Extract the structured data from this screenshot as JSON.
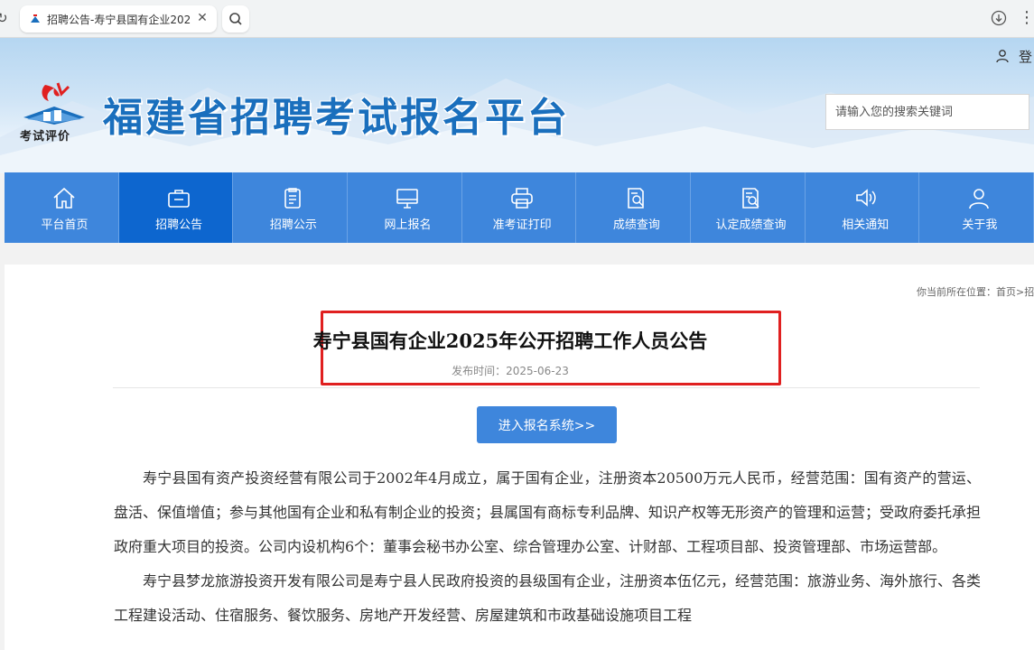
{
  "browser": {
    "tab_title": "招聘公告-寿宁县国有企业202",
    "close_glyph": "✕"
  },
  "header": {
    "login_label": "登",
    "logo_caption": "考试评价",
    "site_title": "福建省招聘考试报名平台",
    "search_placeholder": "请输入您的搜索关键词"
  },
  "nav": {
    "items": [
      {
        "label": "平台首页",
        "icon": "home-icon"
      },
      {
        "label": "招聘公告",
        "icon": "briefcase-icon",
        "active": true
      },
      {
        "label": "招聘公示",
        "icon": "clipboard-icon"
      },
      {
        "label": "网上报名",
        "icon": "monitor-icon"
      },
      {
        "label": "准考证打印",
        "icon": "printer-icon"
      },
      {
        "label": "成绩查询",
        "icon": "document-search-icon"
      },
      {
        "label": "认定成绩查询",
        "icon": "document-check-icon"
      },
      {
        "label": "相关通知",
        "icon": "speaker-icon"
      },
      {
        "label": "关于我",
        "icon": "user-icon"
      }
    ]
  },
  "article": {
    "breadcrumb": "你当前所在位置：首页>招",
    "title": "寿宁县国有企业2025年公开招聘工作人员公告",
    "publish_date": "发布时间：2025-06-23",
    "enter_button": "进入报名系统>>",
    "paragraphs": [
      "寿宁县国有资产投资经营有限公司于2002年4月成立，属于国有企业，注册资本20500万元人民币，经营范围：国有资产的营运、盘活、保值增值；参与其他国有企业和私有制企业的投资；县属国有商标专利品牌、知识产权等无形资产的管理和运营；受政府委托承担政府重大项目的投资。公司内设机构6个：董事会秘书办公室、综合管理办公室、计财部、工程项目部、投资管理部、市场运营部。",
      "寿宁县梦龙旅游投资开发有限公司是寿宁县人民政府投资的县级国有企业，注册资本伍亿元，经营范围：旅游业务、海外旅行、各类工程建设活动、住宿服务、餐饮服务、房地产开发经营、房屋建筑和市政基础设施项目工程"
    ]
  },
  "colors": {
    "nav_bg": "#3e86dc",
    "nav_active": "#0d66cf",
    "title_blue": "#1a6fbd",
    "highlight_red": "#e02020"
  }
}
